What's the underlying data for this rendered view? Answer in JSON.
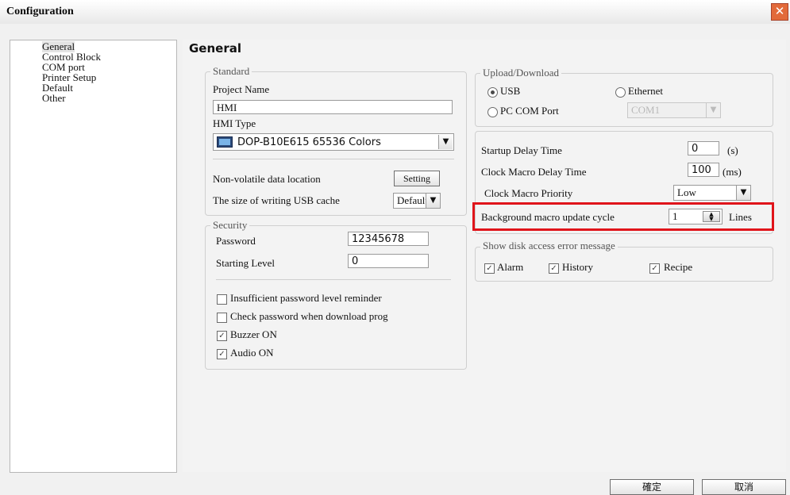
{
  "window": {
    "title": "Configuration"
  },
  "sidebar": {
    "items": [
      "General",
      "Control Block",
      "COM port",
      "Printer Setup",
      "Default",
      "Other"
    ]
  },
  "page": {
    "title": "General"
  },
  "standard": {
    "legend": "Standard",
    "project_name_label": "Project Name",
    "project_name_value": "HMI",
    "hmi_type_label": "HMI Type",
    "hmi_type_value": "DOP-B10E615 65536 Colors",
    "nonvolatile_label": "Non-volatile data location",
    "setting_button": "Setting",
    "usb_cache_label": "The size of writing USB cache",
    "usb_cache_value": "Default"
  },
  "security": {
    "legend": "Security",
    "password_label": "Password",
    "password_value": "12345678",
    "starting_level_label": "Starting Level",
    "starting_level_value": "0",
    "options": [
      {
        "label": "Insufficient password level reminder",
        "checked": false
      },
      {
        "label": "Check password when download prog",
        "checked": false
      },
      {
        "label": "Buzzer ON",
        "checked": true
      },
      {
        "label": "Audio ON",
        "checked": true
      }
    ]
  },
  "upload": {
    "legend": "Upload/Download",
    "usb_label": "USB",
    "ethernet_label": "Ethernet",
    "pccom_label": "PC COM Port",
    "com_value": "COM1",
    "selected": "USB"
  },
  "timing": {
    "startup_label": "Startup Delay Time",
    "startup_value": "0",
    "startup_unit": "(s)",
    "clock_delay_label": "Clock Macro Delay Time",
    "clock_delay_value": "100",
    "clock_delay_unit": "(ms)",
    "clock_priority_label": "Clock Macro Priority",
    "clock_priority_value": "Low",
    "bg_cycle_label": "Background macro update cycle",
    "bg_cycle_value": "1",
    "bg_cycle_unit": "Lines"
  },
  "disk": {
    "legend": "Show disk access error message",
    "alarm_label": "Alarm",
    "history_label": "History",
    "recipe_label": "Recipe"
  },
  "footer": {
    "ok_button": "確定",
    "cancel_button": "取消"
  },
  "icons": {
    "close": "close-icon",
    "dropdown": "chevron-down-icon",
    "spin": "spin-updown-icon",
    "hmi": "monitor-icon"
  },
  "colors": {
    "highlight": "#e0141a",
    "close": "#e26a3a"
  }
}
